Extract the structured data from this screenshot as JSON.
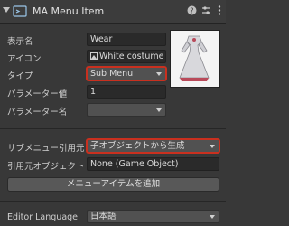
{
  "header": {
    "title": "MA Menu Item",
    "help_icon": "help-icon",
    "settings_icon": "sliders-icon",
    "more_icon": "more-vert-icon"
  },
  "fields": {
    "display_name": {
      "label": "表示名",
      "value": "Wear"
    },
    "icon": {
      "label": "アイコン",
      "value": "White costume"
    },
    "type": {
      "label": "タイプ",
      "value": "Sub Menu"
    },
    "parameter_value": {
      "label": "パラメーター値",
      "value": "1"
    },
    "parameter_name": {
      "label": "パラメーター名",
      "value": ""
    }
  },
  "submenu": {
    "source": {
      "label": "サブメニュー引用元",
      "value": "子オブジェクトから生成"
    },
    "source_object": {
      "label": "引用元オブジェクト",
      "value": "None (Game Object)"
    },
    "add_button": "メニューアイテムを追加"
  },
  "editor_language": {
    "label": "Editor Language",
    "value": "日本語"
  },
  "colors": {
    "highlight": "#c9301f",
    "background": "#383838"
  }
}
